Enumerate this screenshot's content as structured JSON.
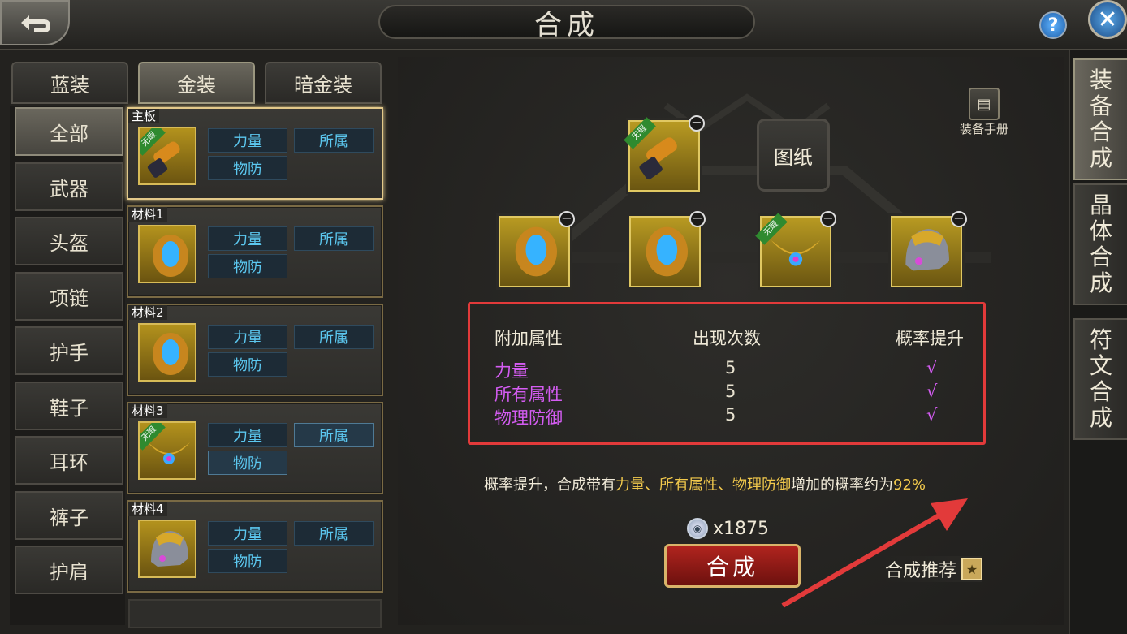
{
  "window": {
    "title": "合成"
  },
  "tabs": [
    "蓝装",
    "金装",
    "暗金装"
  ],
  "categories": [
    "全部",
    "武器",
    "头盔",
    "项链",
    "护手",
    "鞋子",
    "耳环",
    "裤子",
    "护肩"
  ],
  "slots": [
    {
      "tag": "主板",
      "badge": "无瑕",
      "icon": "weapon-icon",
      "attrs": [
        "力量",
        "所属",
        "物防"
      ]
    },
    {
      "tag": "材料1",
      "badge": "",
      "icon": "shoulder-icon",
      "attrs": [
        "力量",
        "所属",
        "物防"
      ]
    },
    {
      "tag": "材料2",
      "badge": "",
      "icon": "shoulder-icon",
      "attrs": [
        "力量",
        "所属",
        "物防"
      ]
    },
    {
      "tag": "材料3",
      "badge": "无瑕",
      "icon": "necklace-icon",
      "attrs": [
        "力量",
        "所属",
        "物防"
      ]
    },
    {
      "tag": "材料4",
      "badge": "",
      "icon": "helmet-icon",
      "attrs": [
        "力量",
        "所属",
        "物防"
      ]
    }
  ],
  "right_tabs": [
    "装备合成",
    "晶体合成",
    "符文合成"
  ],
  "manual_label": "装备手册",
  "blueprint_label": "图纸",
  "main_badge": "无瑕",
  "material_badge": "无瑕",
  "table": {
    "headers": [
      "附加属性",
      "出现次数",
      "概率提升"
    ],
    "rows": [
      {
        "attr": "力量",
        "count": "5",
        "up": "√"
      },
      {
        "attr": "所有属性",
        "count": "5",
        "up": "√"
      },
      {
        "attr": "物理防御",
        "count": "5",
        "up": "√"
      }
    ]
  },
  "desc": {
    "prefix": "概率提升，合成带有",
    "attrs": "力量、所有属性、物理防御",
    "mid": "增加的概率约为",
    "percent": "92%"
  },
  "cost": "x1875",
  "synth_label": "合成",
  "recommend_label": "合成推荐",
  "colors": {
    "gold": "#f2c94c",
    "purple": "#d45cf2",
    "attr_blue": "#5cc8f0",
    "highlight_red": "#e23a3a"
  }
}
